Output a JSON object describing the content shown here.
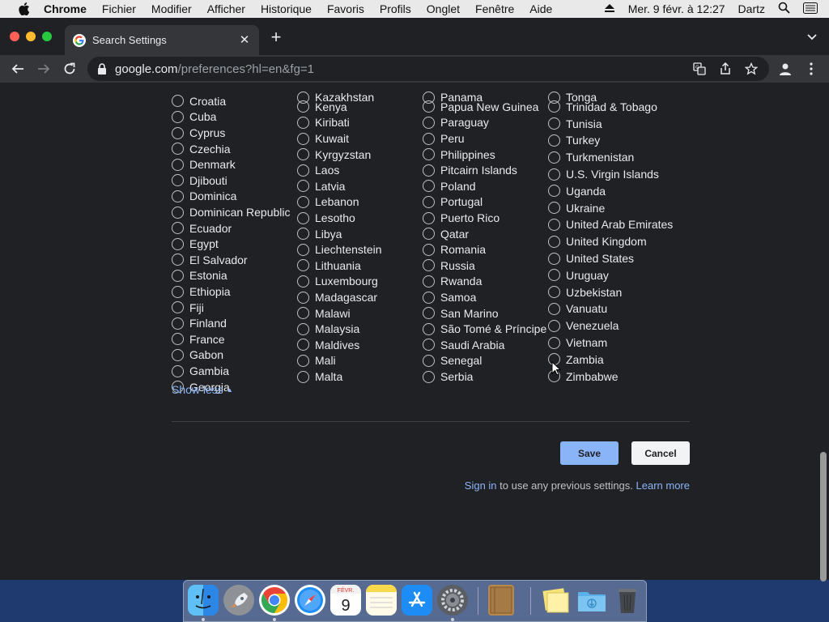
{
  "menubar": {
    "app": "Chrome",
    "items": [
      "Fichier",
      "Modifier",
      "Afficher",
      "Historique",
      "Favoris",
      "Profils",
      "Onglet",
      "Fenêtre",
      "Aide"
    ],
    "datetime": "Mer. 9 févr. à 12:27",
    "user": "Dartz"
  },
  "browser": {
    "tab_title": "Search Settings",
    "url_host": "google.com",
    "url_path": "/preferences?hl=en&fg=1"
  },
  "regions": {
    "col1_partial": "",
    "col1": [
      "Croatia",
      "Cuba",
      "Cyprus",
      "Czechia",
      "Denmark",
      "Djibouti",
      "Dominica",
      "Dominican Republic",
      "Ecuador",
      "Egypt",
      "El Salvador",
      "Estonia",
      "Ethiopia",
      "Fiji",
      "Finland",
      "France",
      "Gabon",
      "Gambia",
      "Georgia"
    ],
    "col2_partial": "Kazakhstan",
    "col2": [
      "Kenya",
      "Kiribati",
      "Kuwait",
      "Kyrgyzstan",
      "Laos",
      "Latvia",
      "Lebanon",
      "Lesotho",
      "Libya",
      "Liechtenstein",
      "Lithuania",
      "Luxembourg",
      "Madagascar",
      "Malawi",
      "Malaysia",
      "Maldives",
      "Mali",
      "Malta"
    ],
    "col3_partial": "Panama",
    "col3": [
      "Papua New Guinea",
      "Paraguay",
      "Peru",
      "Philippines",
      "Pitcairn Islands",
      "Poland",
      "Portugal",
      "Puerto Rico",
      "Qatar",
      "Romania",
      "Russia",
      "Rwanda",
      "Samoa",
      "San Marino",
      "São Tomé & Príncipe",
      "Saudi Arabia",
      "Senegal",
      "Serbia"
    ],
    "col4_partial": "Tonga",
    "col4": [
      "Trinidad & Tobago",
      "Tunisia",
      "Turkey",
      "Turkmenistan",
      "U.S. Virgin Islands",
      "Uganda",
      "Ukraine",
      "United Arab Emirates",
      "United Kingdom",
      "United States",
      "Uruguay",
      "Uzbekistan",
      "Vanuatu",
      "Venezuela",
      "Vietnam",
      "Zambia",
      "Zimbabwe"
    ]
  },
  "actions": {
    "show_less": "Show less",
    "save": "Save",
    "cancel": "Cancel",
    "sign_in": "Sign in",
    "sign_in_suffix": " to use any previous settings. ",
    "learn_more": "Learn more"
  },
  "dock": {
    "calendar_month": "FÉVR.",
    "calendar_day": "9",
    "icons": [
      "finder-icon",
      "launchpad-icon",
      "chrome-icon",
      "safari-icon",
      "calendar-icon",
      "notes-icon",
      "app-store-icon",
      "system-preferences-icon",
      "notebook-icon",
      "stickies-icon",
      "downloads-folder-icon",
      "trash-icon"
    ]
  },
  "colors": {
    "link": "#8ab4f8",
    "page_bg": "#202124",
    "save_bg": "#8ab4f8"
  }
}
